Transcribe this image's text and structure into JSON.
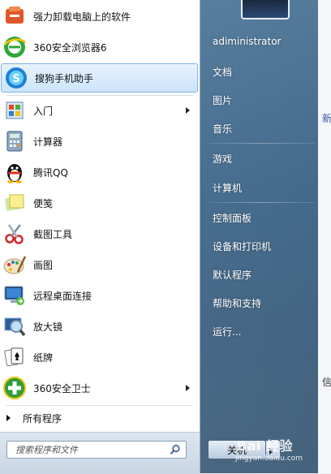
{
  "programs": [
    {
      "label": "强力卸载电脑上的软件",
      "icon": "uninstaller-icon"
    },
    {
      "label": "360安全浏览器6",
      "icon": "360-browser-icon"
    },
    {
      "label": "搜狗手机助手",
      "icon": "sogou-phone-assistant-icon",
      "selected": true
    },
    {
      "label": "入门",
      "icon": "getting-started-icon",
      "submenu": true
    },
    {
      "label": "计算器",
      "icon": "calculator-icon"
    },
    {
      "label": "腾讯QQ",
      "icon": "qq-penguin-icon"
    },
    {
      "label": "便笺",
      "icon": "sticky-notes-icon"
    },
    {
      "label": "截图工具",
      "icon": "snipping-tool-icon"
    },
    {
      "label": "画图",
      "icon": "paint-icon"
    },
    {
      "label": "远程桌面连接",
      "icon": "remote-desktop-icon"
    },
    {
      "label": "放大镜",
      "icon": "magnifier-icon"
    },
    {
      "label": "纸牌",
      "icon": "solitaire-icon"
    },
    {
      "label": "360安全卫士",
      "icon": "360-safeguard-icon",
      "submenu": true
    }
  ],
  "all_programs_label": "所有程序",
  "search": {
    "placeholder": "搜索程序和文件"
  },
  "user": {
    "name": "adiministrator"
  },
  "right_links": {
    "documents": "文档",
    "pictures": "图片",
    "music": "音乐",
    "games": "游戏",
    "computer": "计算机",
    "control_panel": "控制面板",
    "devices_printers": "设备和打印机",
    "default_programs": "默认程序",
    "help_support": "帮助和支持",
    "run": "运行..."
  },
  "shutdown_label": "关机",
  "watermark": {
    "text": "Bai 经验",
    "sub": "jingyan.baidu.com"
  },
  "background_fragments": {
    "new": "新",
    "sheet": "信"
  },
  "colors": {
    "selection_border": "#7fb3e6",
    "right_pane": "#44698a"
  }
}
